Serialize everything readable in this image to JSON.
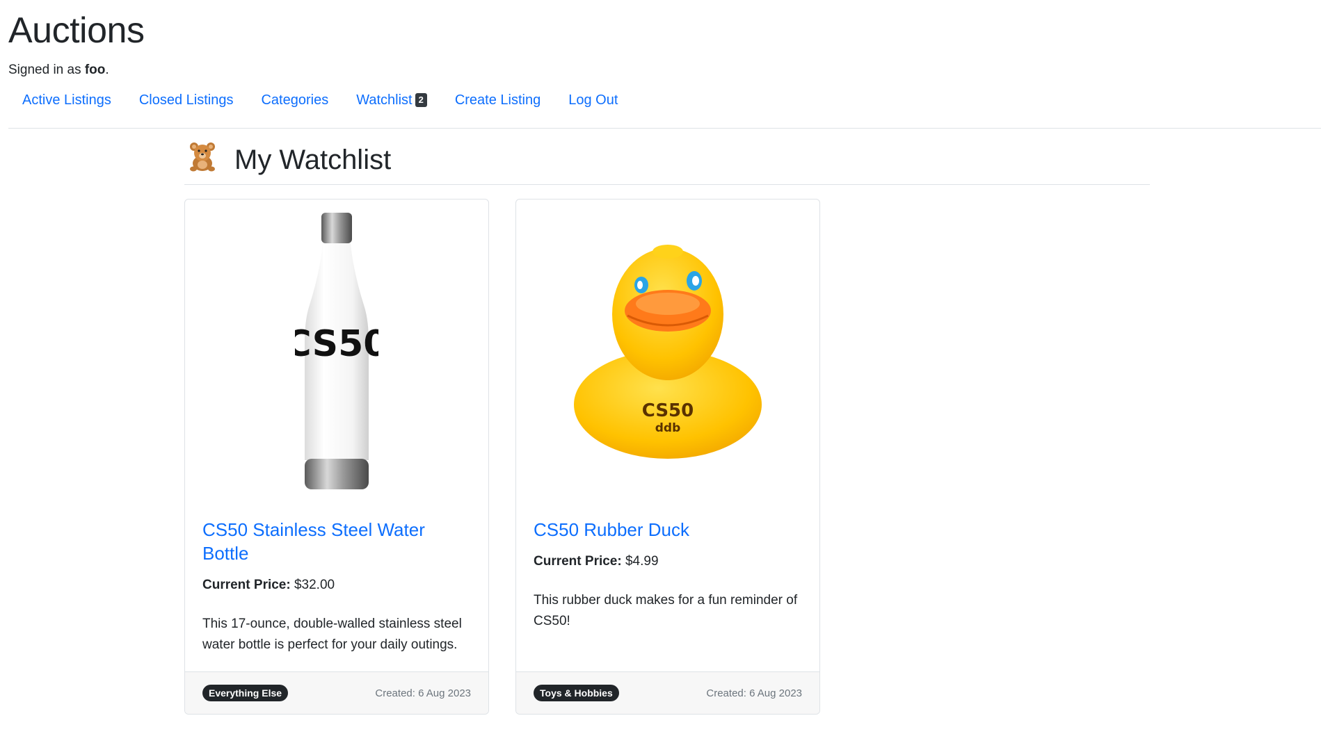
{
  "site": {
    "title": "Auctions",
    "signed_in_prefix": "Signed in as",
    "username": "foo",
    "signed_in_suffix": "."
  },
  "nav": {
    "active_listings": "Active Listings",
    "closed_listings": "Closed Listings",
    "categories": "Categories",
    "watchlist": "Watchlist",
    "watchlist_count": "2",
    "create_listing": "Create Listing",
    "log_out": "Log Out"
  },
  "page": {
    "heading_icon": "teddy-bear-icon",
    "heading": "My Watchlist"
  },
  "listings": [
    {
      "image": "water-bottle-image",
      "bottle_text": "CS50",
      "title": "CS50 Stainless Steel Water Bottle",
      "price_label": "Current Price:",
      "price": "$32.00",
      "description": "This 17-ounce, double-walled stainless steel water bottle is perfect for your daily outings.",
      "category": "Everything Else",
      "created": "Created: 6 Aug 2023"
    },
    {
      "image": "rubber-duck-image",
      "duck_text_1": "CS50",
      "duck_text_2": "ddb",
      "title": "CS50 Rubber Duck",
      "price_label": "Current Price:",
      "price": "$4.99",
      "description": "This rubber duck makes for a fun reminder of CS50!",
      "category": "Toys & Hobbies",
      "created": "Created: 6 Aug 2023"
    }
  ],
  "colors": {
    "link": "#0d6efd",
    "badge": "#212529",
    "duck": "#ffc200",
    "beak": "#ff7a1a"
  }
}
